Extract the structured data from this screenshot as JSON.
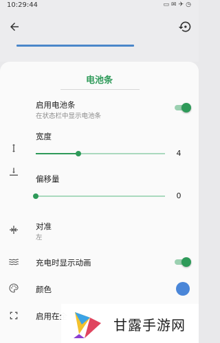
{
  "status_bar": {
    "time": "10:29:44",
    "icons": [
      "cast-icon",
      "mail-icon",
      "airplane-icon",
      "alarm-icon"
    ]
  },
  "appbar": {
    "back_icon": "arrow-left-icon",
    "reset_icon": "history-icon",
    "preview_bar_color": "#4a86c9"
  },
  "sheet": {
    "title": "电池条",
    "enable": {
      "title": "启用电池条",
      "subtitle": "在状态栏中显示电池条",
      "on": true
    },
    "width": {
      "title": "宽度",
      "value": "4",
      "fraction": 0.33
    },
    "offset": {
      "title": "偏移量",
      "value": "0",
      "fraction": 0.0
    },
    "align": {
      "title": "对准",
      "value": "左"
    },
    "charging_anim": {
      "title": "充电时显示动画",
      "on": true
    },
    "color": {
      "title": "颜色",
      "swatch": "#4a86d8"
    },
    "fullscreen": {
      "title": "启用在全"
    }
  },
  "accent_color": "#2e9a59",
  "watermark": {
    "text": "甘露手游网"
  }
}
